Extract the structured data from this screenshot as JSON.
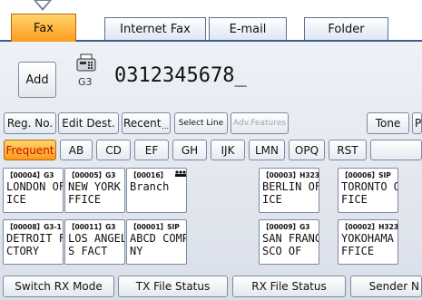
{
  "tabs": [
    {
      "label": "Fax",
      "active": true
    },
    {
      "label": "Internet Fax",
      "active": false
    },
    {
      "label": "E-mail",
      "active": false
    },
    {
      "label": "Folder",
      "active": false
    }
  ],
  "destination": {
    "add_label": "Add",
    "line_type": "G3",
    "number": "0312345678_"
  },
  "toolbar": {
    "reg_no": "Reg. No.",
    "edit_dest": "Edit Dest.",
    "recent": "Recent",
    "select_line": "Select Line",
    "adv_features": "Adv.Features",
    "tone": "Tone",
    "pause": "P"
  },
  "index_tabs": [
    "Frequent",
    "AB",
    "CD",
    "EF",
    "GH",
    "IJK",
    "LMN",
    "OPQ",
    "RST",
    ""
  ],
  "destinations": [
    {
      "code": "【00004】G3",
      "name": "LONDON OFF\nICE"
    },
    {
      "code": "【00005】G3",
      "name": "NEW YORK O\nFFICE"
    },
    {
      "code": "【00016】",
      "name": "Branch",
      "group": true
    },
    {
      "code": "【00003】H323",
      "name": "BERLIN OFF\nICE"
    },
    {
      "code": "【00006】SIP",
      "name": "TORONTO OF\nFICE"
    },
    {
      "code": "【00008】G3-1",
      "name": "DETROIT FA\nCTORY"
    },
    {
      "code": "【00011】G3",
      "name": "LOS ANGELE\nS FACT"
    },
    {
      "code": "【00001】SIP",
      "name": "ABCD COMPA\nNY"
    },
    {
      "code": "【00009】G3",
      "name": "SAN FRANCI\nSCO OF"
    },
    {
      "code": "【00002】H323",
      "name": "YOKOHAMA O\nFFICE"
    }
  ],
  "bottom": {
    "switch_rx": "Switch RX Mode",
    "tx_status": "TX File Status",
    "rx_status": "RX File Status",
    "sender": "Sender N"
  },
  "colors": {
    "active_tab": "#ff9a1c",
    "frequent_text": "#c41000",
    "panel": "#d9dfe9"
  },
  "icons": {
    "fax": "fax-machine-icon",
    "group": "group-icon"
  }
}
